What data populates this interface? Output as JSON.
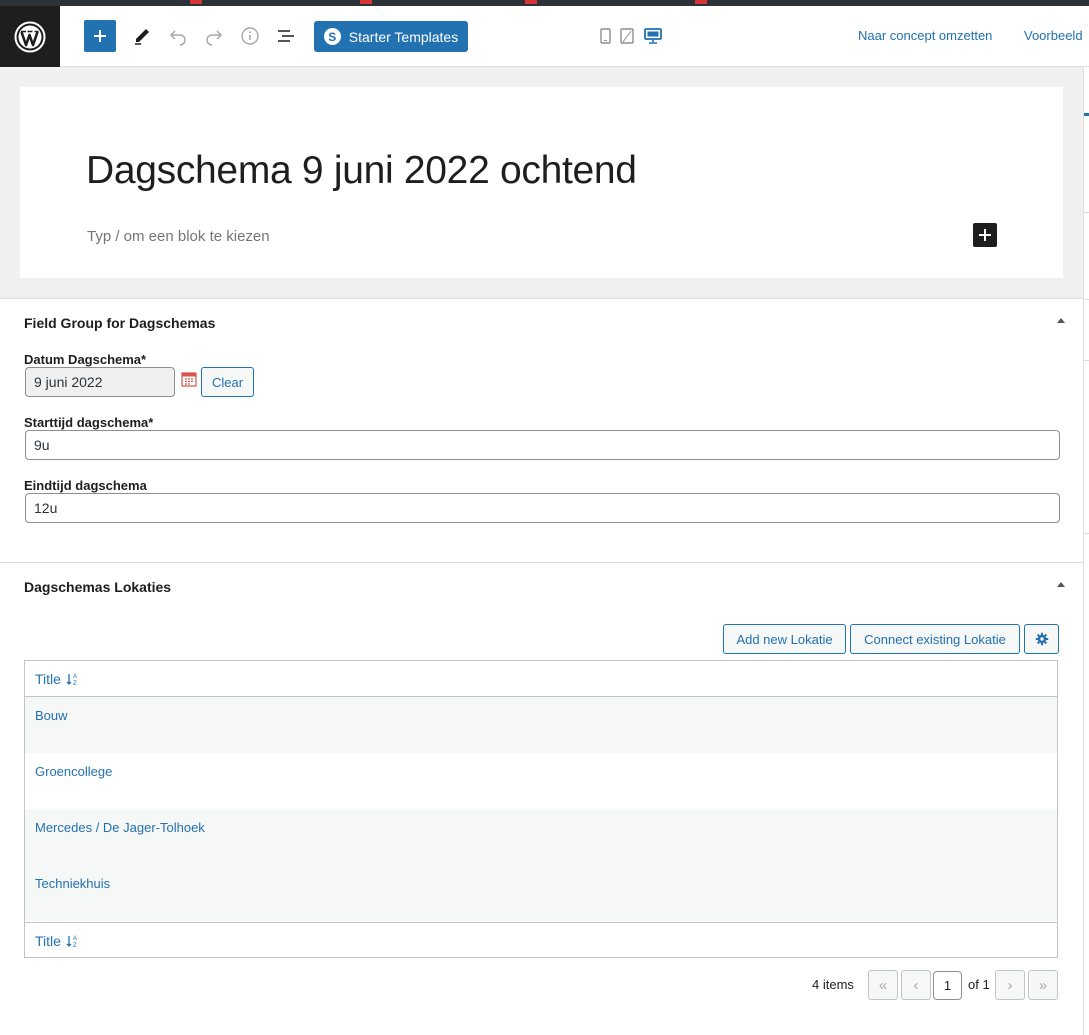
{
  "toolbar": {
    "starter_templates_label": "Starter Templates",
    "switch_to_draft_label": "Naar concept omzetten",
    "preview_label": "Voorbeeld"
  },
  "editor": {
    "post_title": "Dagschema 9 juni 2022 ochtend",
    "block_placeholder": "Typ / om een blok te kiezen"
  },
  "field_group": {
    "title": "Field Group for Dagschemas",
    "fields": {
      "date": {
        "label": "Datum Dagschema*",
        "value": "9 juni 2022",
        "clear_label": "Clear"
      },
      "start": {
        "label": "Starttijd dagschema*",
        "value": "9u"
      },
      "end": {
        "label": "Eindtijd dagschema",
        "value": "12u"
      }
    }
  },
  "locations_box": {
    "title": "Dagschemas Lokaties",
    "add_new_label": "Add new Lokatie",
    "connect_existing_label": "Connect existing Lokatie",
    "column_header": "Title",
    "rows": [
      "Bouw",
      "Groencollege",
      "Mercedes / De Jager-Tolhoek",
      "Techniekhuis"
    ],
    "pagination": {
      "item_count": "4 items",
      "current_page": "1",
      "of_pages": "of 1"
    }
  },
  "colors": {
    "accent": "#2271b1",
    "dark": "#1e1e1e"
  }
}
